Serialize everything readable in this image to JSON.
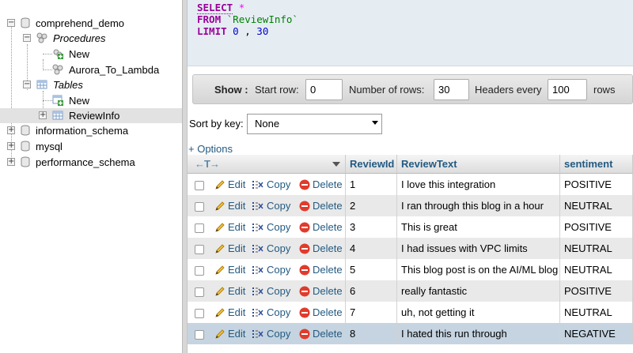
{
  "nav": {
    "db1": "comprehend_demo",
    "procedures": "Procedures",
    "proc_new": "New",
    "proc_aurora": "Aurora_To_Lambda",
    "tables": "Tables",
    "tables_new": "New",
    "review_info": "ReviewInfo",
    "db2": "information_schema",
    "db3": "mysql",
    "db4": "performance_schema"
  },
  "sql": {
    "line1_kw": "SELECT",
    "line1_rest": "*",
    "line2_kw": "FROM",
    "line2_rest": "`ReviewInfo`",
    "line3_kw": "LIMIT",
    "line3_a": "0",
    "line3_sep": ",",
    "line3_b": "30"
  },
  "show_bar": {
    "show_label": "Show :",
    "start_row_label": "Start row:",
    "start_row_value": "0",
    "num_rows_label": "Number of rows:",
    "num_rows_value": "30",
    "headers_every_label": "Headers every",
    "headers_every_value": "100",
    "rows_label": "rows"
  },
  "sort": {
    "label": "Sort by key:",
    "selected": "None"
  },
  "options_link": "+ Options",
  "table": {
    "columns": [
      "ReviewId",
      "ReviewText",
      "sentiment"
    ],
    "actions": {
      "edit": "Edit",
      "copy": "Copy",
      "delete": "Delete"
    },
    "rows": [
      {
        "id": "1",
        "text": "I love this integration",
        "sentiment": "POSITIVE"
      },
      {
        "id": "2",
        "text": "I ran through this blog in a hour",
        "sentiment": "NEUTRAL"
      },
      {
        "id": "3",
        "text": "This is great",
        "sentiment": "POSITIVE"
      },
      {
        "id": "4",
        "text": "I had issues with VPC limits",
        "sentiment": "NEUTRAL"
      },
      {
        "id": "5",
        "text": "This blog post is on the AI/ML blog",
        "sentiment": "NEUTRAL"
      },
      {
        "id": "6",
        "text": "really fantastic",
        "sentiment": "POSITIVE"
      },
      {
        "id": "7",
        "text": "uh, not getting it",
        "sentiment": "NEUTRAL"
      },
      {
        "id": "8",
        "text": "I hated this run through",
        "sentiment": "NEGATIVE"
      }
    ]
  },
  "colors": {
    "link": "#235a81",
    "sql_keyword": "#990099",
    "sql_string": "#008000",
    "row_marked": "#c5d4e0"
  }
}
